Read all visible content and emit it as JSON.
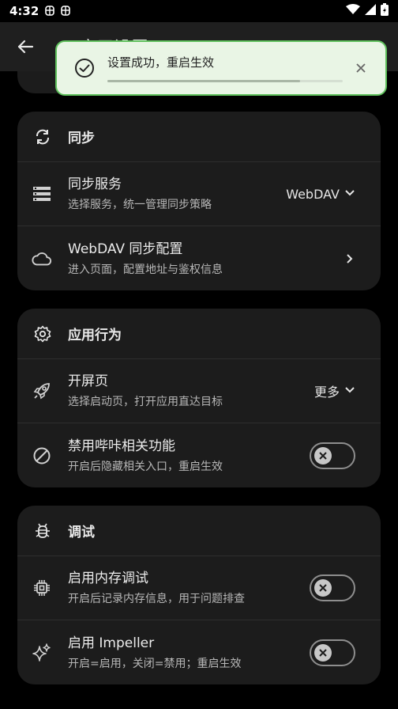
{
  "status_bar": {
    "time": "4:32",
    "notif_icons": [
      "bug-icon",
      "bug-icon"
    ],
    "right_icons": [
      "wifi-icon",
      "signal-icon",
      "battery-icon"
    ]
  },
  "app_bar": {
    "title": "应用设置"
  },
  "toast": {
    "message": "设置成功，重启生效",
    "progress": 0.82,
    "accent": "#5fc15c"
  },
  "sections": {
    "sync": {
      "title": "同步",
      "sync_service": {
        "title": "同步服务",
        "subtitle": "选择服务，统一管理同步策略",
        "value": "WebDAV"
      },
      "webdav": {
        "title": "WebDAV 同步配置",
        "subtitle": "进入页面，配置地址与鉴权信息"
      }
    },
    "behavior": {
      "title": "应用行为",
      "splash": {
        "title": "开屏页",
        "subtitle": "选择启动页，打开应用直达目标",
        "value": "更多"
      },
      "disable_bili": {
        "title": "禁用哔咔相关功能",
        "subtitle": "开启后隐藏相关入口，重启生效",
        "enabled": false
      }
    },
    "debug": {
      "title": "调试",
      "memory_debug": {
        "title": "启用内存调试",
        "subtitle": "开启后记录内存信息，用于问题排查",
        "enabled": false
      },
      "impeller": {
        "title": "启用 Impeller",
        "subtitle": "开启=启用，关闭=禁用；重启生效",
        "enabled": false
      }
    }
  }
}
